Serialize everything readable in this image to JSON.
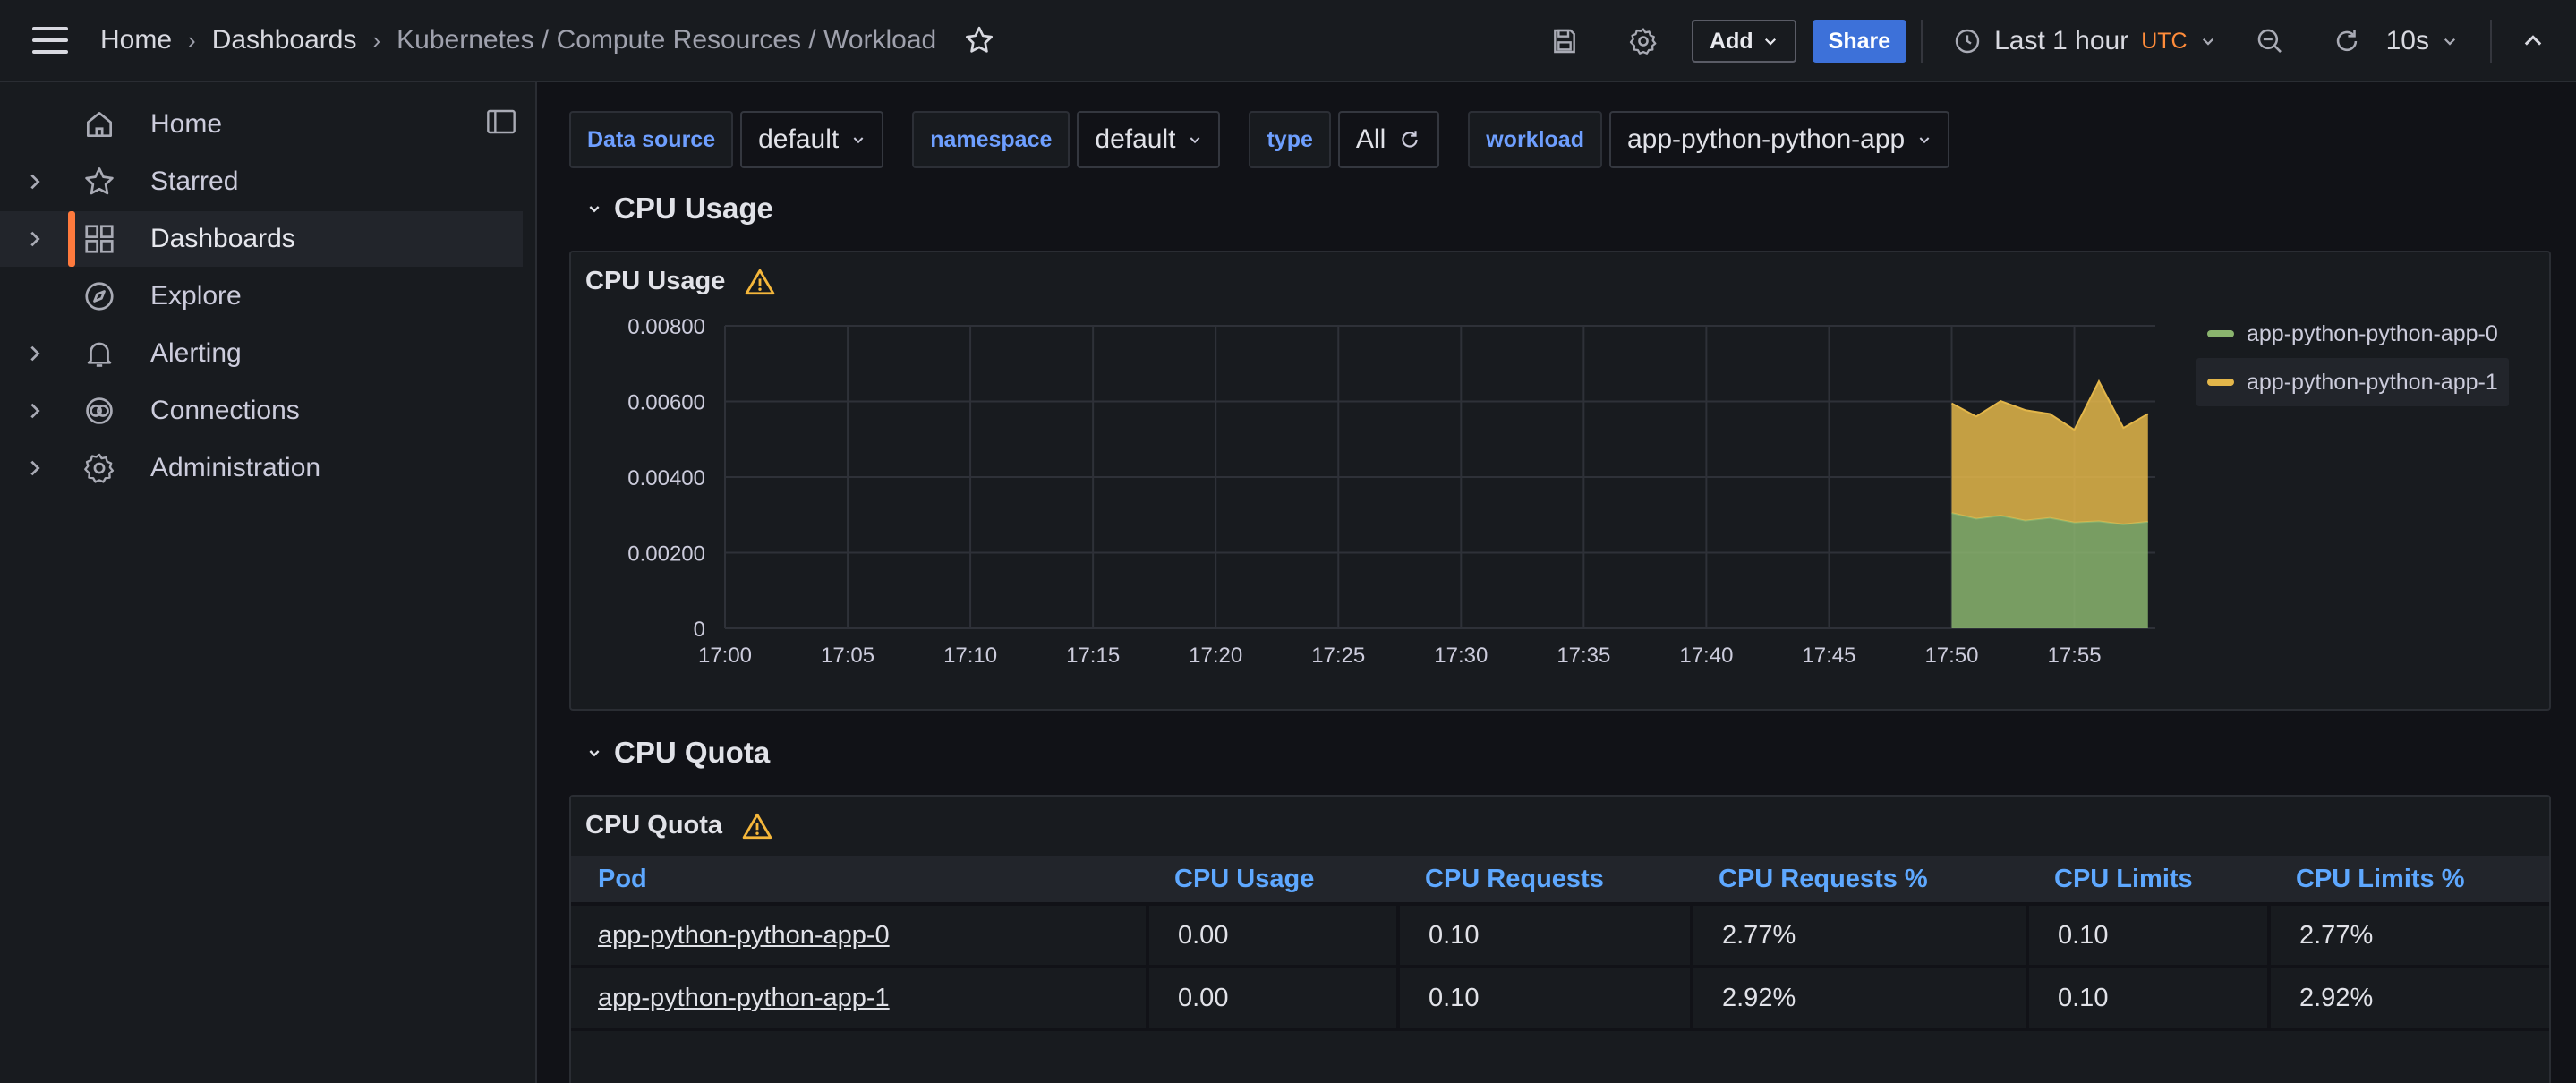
{
  "topbar": {
    "breadcrumbs": [
      "Home",
      "Dashboards",
      "Kubernetes / Compute Resources / Workload"
    ],
    "add_label": "Add",
    "share_label": "Share",
    "time_range": "Last 1 hour",
    "timezone": "UTC",
    "refresh_interval": "10s"
  },
  "sidebar": {
    "items": [
      {
        "label": "Home",
        "icon": "home-icon",
        "expandable": false
      },
      {
        "label": "Starred",
        "icon": "star-icon",
        "expandable": true
      },
      {
        "label": "Dashboards",
        "icon": "dashboards-grid-icon",
        "expandable": true,
        "active": true
      },
      {
        "label": "Explore",
        "icon": "compass-icon",
        "expandable": false
      },
      {
        "label": "Alerting",
        "icon": "bell-icon",
        "expandable": true
      },
      {
        "label": "Connections",
        "icon": "connections-icon",
        "expandable": true
      },
      {
        "label": "Administration",
        "icon": "gear-icon",
        "expandable": true
      }
    ]
  },
  "variables": {
    "datasource": {
      "label": "Data source",
      "value": "default"
    },
    "namespace": {
      "label": "namespace",
      "value": "default"
    },
    "type": {
      "label": "type",
      "value": "All"
    },
    "workload": {
      "label": "workload",
      "value": "app-python-python-app"
    }
  },
  "rows": {
    "cpu_usage": "CPU Usage",
    "cpu_quota": "CPU Quota"
  },
  "cpu_usage_panel": {
    "title": "CPU Usage"
  },
  "cpu_quota_panel": {
    "title": "CPU Quota",
    "columns": [
      "Pod",
      "CPU Usage",
      "CPU Requests",
      "CPU Requests %",
      "CPU Limits",
      "CPU Limits %"
    ],
    "rows": [
      [
        "app-python-python-app-0",
        "0.00",
        "0.10",
        "2.77%",
        "0.10",
        "2.77%"
      ],
      [
        "app-python-python-app-1",
        "0.00",
        "0.10",
        "2.92%",
        "0.10",
        "2.92%"
      ]
    ]
  },
  "colors": {
    "series0": "#8ab46e",
    "series1": "#e3b64a",
    "accent": "#ff7a3d",
    "link": "#5ea8ff",
    "share": "#3d71d9"
  },
  "chart_data": {
    "type": "area",
    "stacked": true,
    "title": "CPU Usage",
    "x_ticks": [
      "17:00",
      "17:05",
      "17:10",
      "17:15",
      "17:20",
      "17:25",
      "17:30",
      "17:35",
      "17:40",
      "17:45",
      "17:50",
      "17:55"
    ],
    "y_ticks": [
      "0",
      "0.00200",
      "0.00400",
      "0.00600",
      "0.00800"
    ],
    "ylim": [
      0,
      0.008
    ],
    "xlim_minutes": [
      0,
      58.3
    ],
    "grid": true,
    "legend_position": "right",
    "x_minutes": [
      50,
      51,
      52,
      53,
      54,
      55,
      56,
      57,
      58
    ],
    "series": [
      {
        "name": "app-python-python-app-0",
        "color": "#8ab46e",
        "values": [
          0.00305,
          0.0029,
          0.00298,
          0.00285,
          0.00292,
          0.0028,
          0.00283,
          0.00275,
          0.00282
        ]
      },
      {
        "name": "app-python-python-app-1",
        "color": "#e3b64a",
        "values": [
          0.0029,
          0.0027,
          0.00303,
          0.00292,
          0.00275,
          0.00245,
          0.0037,
          0.00255,
          0.00285
        ]
      }
    ]
  }
}
